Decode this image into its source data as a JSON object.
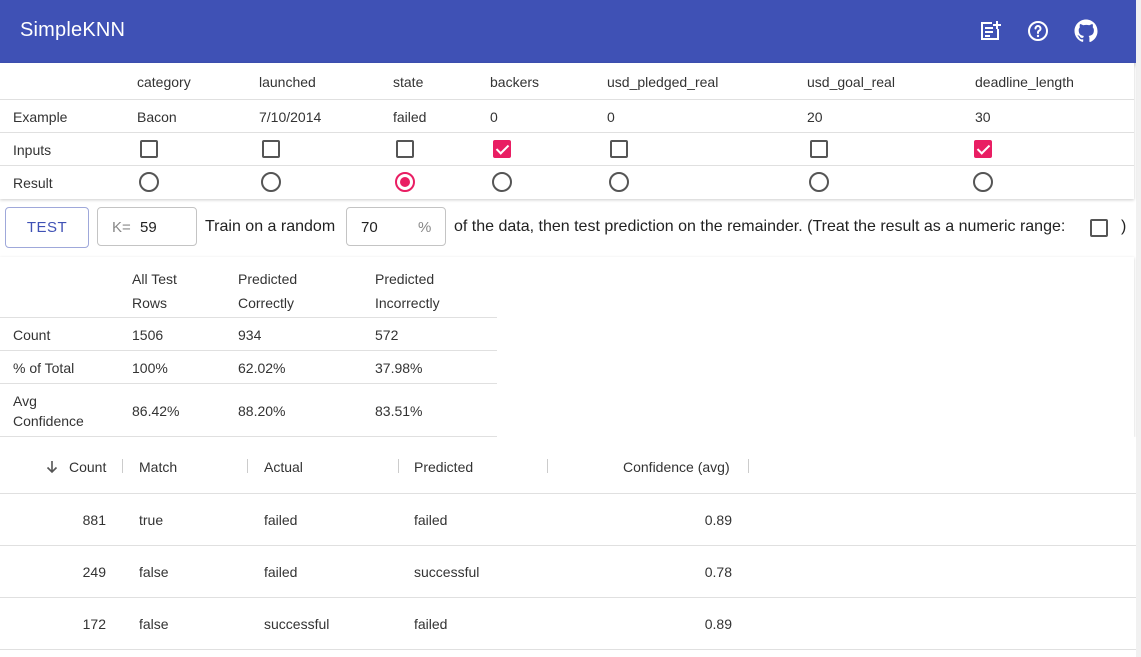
{
  "app": {
    "title": "SimpleKNN"
  },
  "icons": {
    "notes": "note-add-icon",
    "help": "help-circle-icon",
    "github": "github-icon"
  },
  "colors": {
    "primary": "#3f51b5",
    "accent": "#e91e63"
  },
  "config": {
    "columns": [
      "category",
      "launched",
      "state",
      "backers",
      "usd_pledged_real",
      "usd_goal_real",
      "deadline_length"
    ],
    "row_labels": {
      "example": "Example",
      "inputs": "Inputs",
      "result": "Result"
    },
    "example": [
      "Bacon",
      "7/10/2014",
      "failed",
      "0",
      "0",
      "20",
      "30"
    ],
    "inputs": [
      false,
      false,
      false,
      true,
      false,
      false,
      true
    ],
    "result_index": 2
  },
  "controls": {
    "test_label": "TEST",
    "k_label": "K=",
    "k_value": "59",
    "train_prefix": "Train on a random",
    "percent_value": "70",
    "percent_suffix": "%",
    "train_suffix": "of the data, then test prediction on the remainder. (Treat the result as a numeric range:",
    "closing": ")",
    "numeric_range": false
  },
  "summary": {
    "headers": [
      [
        "All Test",
        "Rows"
      ],
      [
        "Predicted",
        "Correctly"
      ],
      [
        "Predicted",
        "Incorrectly"
      ]
    ],
    "rows": [
      {
        "label": [
          "Count"
        ],
        "values": [
          "1506",
          "934",
          "572"
        ]
      },
      {
        "label": [
          "% of Total"
        ],
        "values": [
          "100%",
          "62.02%",
          "37.98%"
        ]
      },
      {
        "label": [
          "Avg",
          "Confidence"
        ],
        "values": [
          "86.42%",
          "88.20%",
          "83.51%"
        ]
      }
    ]
  },
  "table": {
    "columns": [
      "Count",
      "Match",
      "Actual",
      "Predicted",
      "Confidence (avg)"
    ],
    "rows": [
      [
        "881",
        "true",
        "failed",
        "failed",
        "0.89"
      ],
      [
        "249",
        "false",
        "failed",
        "successful",
        "0.78"
      ],
      [
        "172",
        "false",
        "successful",
        "failed",
        "0.89"
      ]
    ]
  }
}
